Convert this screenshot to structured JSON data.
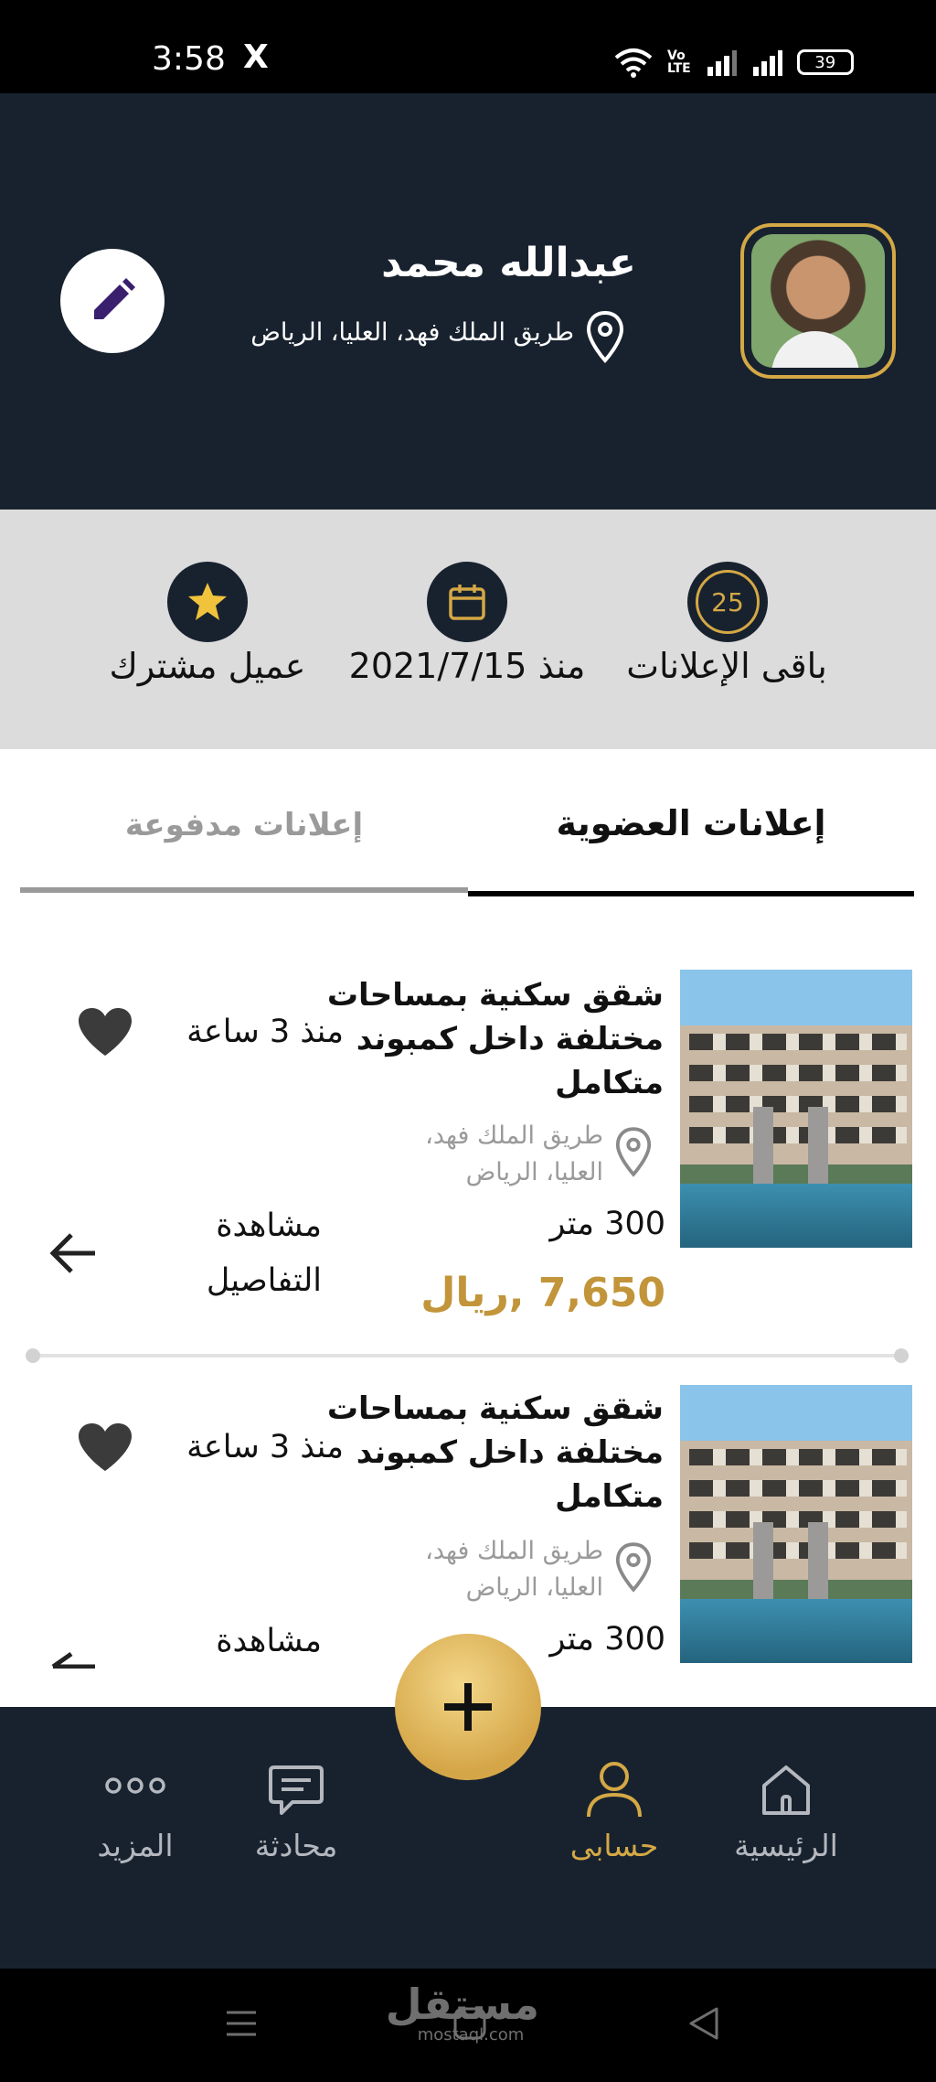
{
  "status_bar": {
    "time": "3:58",
    "x_app": "X",
    "volte": "Vo\nLTE",
    "battery": "39"
  },
  "profile": {
    "name": "عبدالله محمد",
    "address": "طريق الملك فهد، العليا، الرياض"
  },
  "stats": [
    {
      "label": "باقى الإعلانات",
      "badge": "25"
    },
    {
      "label": "منذ 2021/7/15"
    },
    {
      "label": "عميل مشترك"
    }
  ],
  "tabs": {
    "active": "إعلانات العضوية",
    "inactive": "إعلانات مدفوعة"
  },
  "listings": [
    {
      "title_line1": "شقق سكنية بمساحات",
      "title_line2": "مختلفة داخل كمبوند",
      "title_line3": "متكامل",
      "addr_line1": "طريق الملك فهد،",
      "addr_line2": "العليا، الرياض",
      "area": "300 متر",
      "price": "7,650 ,ريال",
      "time": "منذ 3 ساعة",
      "details_line1": "مشاهدة",
      "details_line2": "التفاصيل"
    },
    {
      "title_line1": "شقق سكنية بمساحات",
      "title_line2": "مختلفة داخل كمبوند",
      "title_line3": "متكامل",
      "addr_line1": "طريق الملك فهد،",
      "addr_line2": "العليا، الرياض",
      "area": "300 متر",
      "time": "منذ 3 ساعة",
      "details_line1": "مشاهدة"
    }
  ],
  "bottom_nav": {
    "home": "الرئيسية",
    "account": "حسابى",
    "chat": "محادثة",
    "more": "المزيد"
  },
  "watermark": {
    "brand": "مستقل",
    "domain": "mostaql.com"
  },
  "colors": {
    "navy": "#18222f",
    "gold": "#d4a845",
    "price": "#c2953a",
    "band": "#dcdcdc"
  }
}
